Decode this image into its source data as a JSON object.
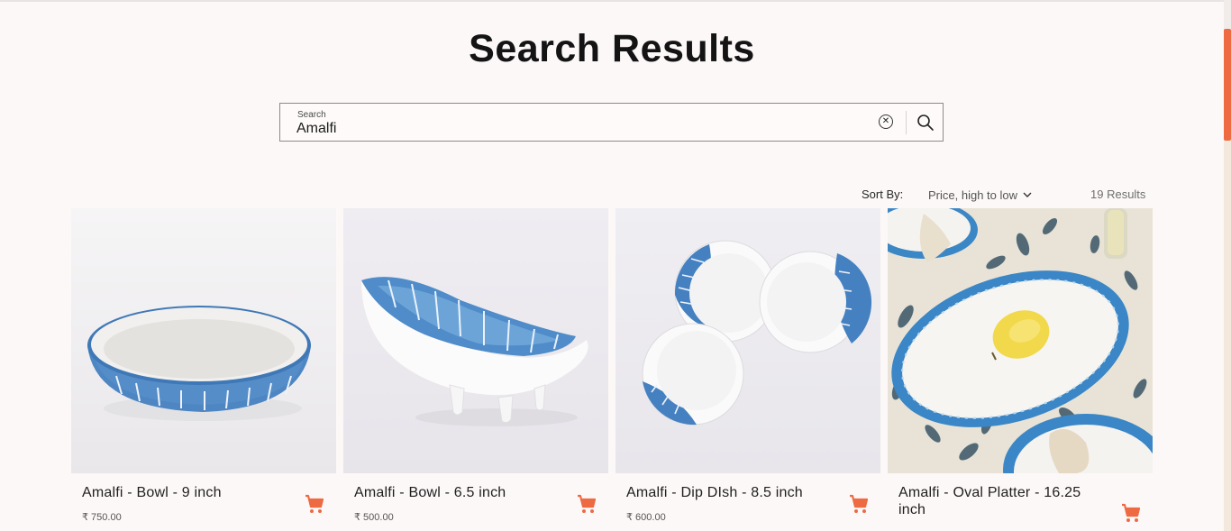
{
  "page": {
    "title": "Search Results"
  },
  "search": {
    "label": "Search",
    "value": "Amalfi",
    "clear_icon": "close-circle-icon",
    "submit_icon": "search-icon"
  },
  "toolbar": {
    "sort_label": "Sort By:",
    "sort_value": "Price, high to low",
    "sort_icon": "chevron-down-icon",
    "result_count": "19 Results"
  },
  "products": [
    {
      "name": "Amalfi - Bowl - 9 inch",
      "price": "₹ 750.00"
    },
    {
      "name": "Amalfi - Bowl - 6.5 inch",
      "price": "₹ 500.00"
    },
    {
      "name": "Amalfi - Dip DIsh - 8.5 inch",
      "price": "₹ 600.00"
    },
    {
      "name": "Amalfi - Oval Platter - 16.25 inch",
      "price": ""
    }
  ],
  "colors": {
    "accent": "#ee6a43",
    "background": "#fcf8f7",
    "glaze_blue": "#3d7fc0"
  },
  "icons": {
    "cart": "shopping-cart-icon"
  }
}
